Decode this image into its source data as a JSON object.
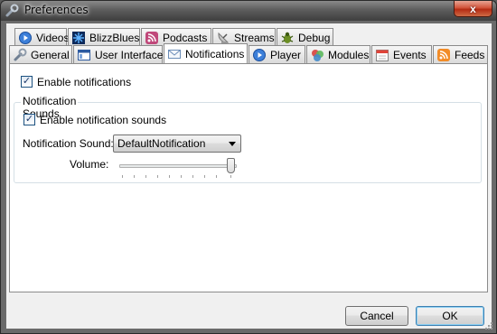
{
  "window": {
    "title": "Preferences",
    "close_glyph": "x"
  },
  "tabs_row1": [
    {
      "label": "Videos",
      "icon": "play-circle-icon"
    },
    {
      "label": "BlizzBlues",
      "icon": "blizzard-icon"
    },
    {
      "label": "Podcasts",
      "icon": "rss-podcast-icon"
    },
    {
      "label": "Streams",
      "icon": "satellite-dish-icon"
    },
    {
      "label": "Debug",
      "icon": "bug-icon"
    }
  ],
  "tabs_row2": [
    {
      "label": "General",
      "icon": "wrench-icon"
    },
    {
      "label": "User Interface",
      "icon": "window-icon"
    },
    {
      "label": "Notifications",
      "icon": "envelope-icon",
      "active": true
    },
    {
      "label": "Player",
      "icon": "play-circle-icon"
    },
    {
      "label": "Modules",
      "icon": "modules-icon"
    },
    {
      "label": "Events",
      "icon": "calendar-icon"
    },
    {
      "label": "Feeds",
      "icon": "rss-feed-icon"
    }
  ],
  "notifications": {
    "enable_label": "Enable notifications",
    "enable_checked": true,
    "group_title": "Notification Sounds",
    "enable_sounds_label": "Enable notification sounds",
    "enable_sounds_checked": true,
    "sound_label": "Notification Sound:",
    "sound_value": "DefaultNotification",
    "volume_label": "Volume:",
    "volume_level_fraction": 1.0
  },
  "buttons": {
    "cancel": "Cancel",
    "ok": "OK"
  },
  "colors": {
    "accent": "#3c7fb1",
    "close": "#c33a1e"
  }
}
